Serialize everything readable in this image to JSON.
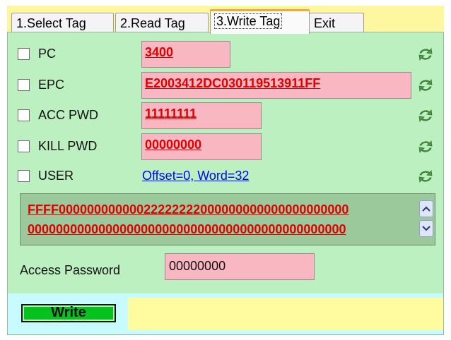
{
  "tabs": [
    {
      "label": "1.Select Tag",
      "active": false
    },
    {
      "label": "2.Read Tag",
      "active": false
    },
    {
      "label": "3.Write Tag",
      "active": true
    },
    {
      "label": "Exit",
      "active": false
    }
  ],
  "fields": {
    "pc": {
      "label": "PC",
      "value": "3400",
      "checked": false
    },
    "epc": {
      "label": "EPC",
      "value": "E2003412DC030119513911FF",
      "checked": false
    },
    "acc_pwd": {
      "label": "ACC PWD",
      "value": "11111111",
      "checked": false
    },
    "kill_pwd": {
      "label": "KILL PWD",
      "value": "00000000",
      "checked": false
    },
    "user": {
      "label": "USER",
      "link_text": "Offset=0, Word=32",
      "checked": false
    }
  },
  "user_data": {
    "line1": "FFFF00000000000022222222000000000000000000000",
    "line2": "000000000000000000000000000000000000000000000"
  },
  "access_password": {
    "label": "Access Password",
    "value": "00000000"
  },
  "write_button": {
    "label": "Write"
  },
  "colors": {
    "panel_bg": "#bdf0c0",
    "value_bg": "#f9b7c2",
    "value_text": "#e00000",
    "tab_bar_bg": "#fff6a0",
    "write_button_bg": "#05c21f",
    "bottom_bar_bg": "#c7fbff"
  },
  "icons": {
    "refresh": "refresh-icon",
    "scroll_up": "chevron-up-icon",
    "scroll_down": "chevron-down-icon"
  }
}
